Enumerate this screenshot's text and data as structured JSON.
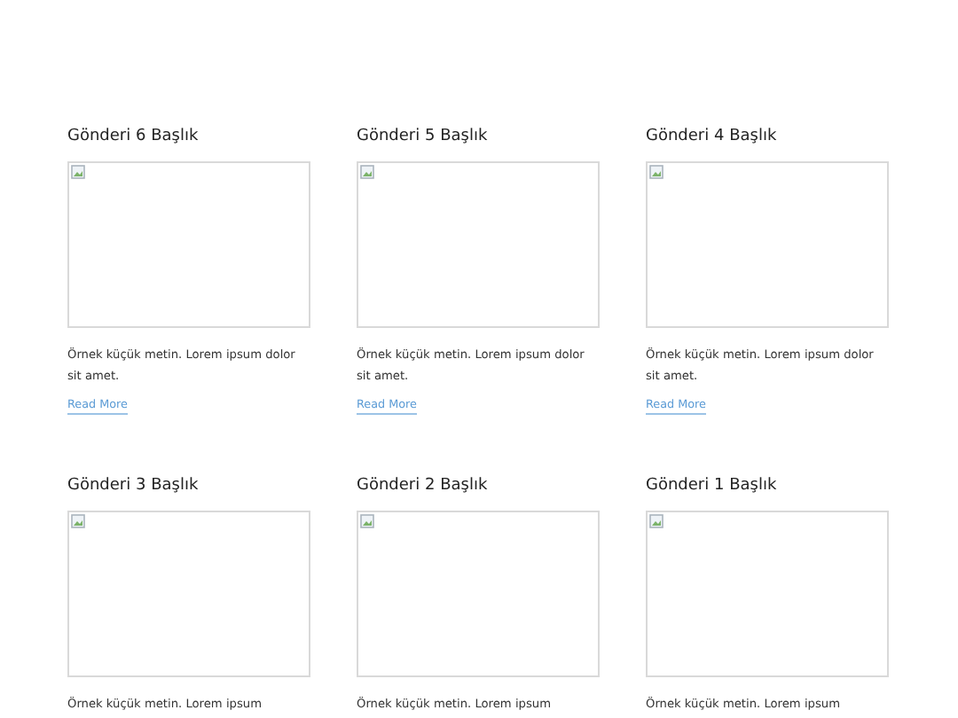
{
  "posts": [
    {
      "title": "Gönderi 6 Başlık",
      "excerpt": "Örnek küçük metin. Lorem ipsum dolor sit amet.",
      "read_more": "Read More"
    },
    {
      "title": "Gönderi 5 Başlık",
      "excerpt": "Örnek küçük metin. Lorem ipsum dolor sit amet.",
      "read_more": "Read More"
    },
    {
      "title": "Gönderi 4 Başlık",
      "excerpt": "Örnek küçük metin. Lorem ipsum dolor sit amet.",
      "read_more": "Read More"
    },
    {
      "title": "Gönderi 3 Başlık",
      "excerpt": "Örnek küçük metin. Lorem ipsum"
    },
    {
      "title": "Gönderi 2 Başlık",
      "excerpt": "Örnek küçük metin. Lorem ipsum"
    },
    {
      "title": "Gönderi 1 Başlık",
      "excerpt": "Örnek küçük metin. Lorem ipsum"
    }
  ]
}
